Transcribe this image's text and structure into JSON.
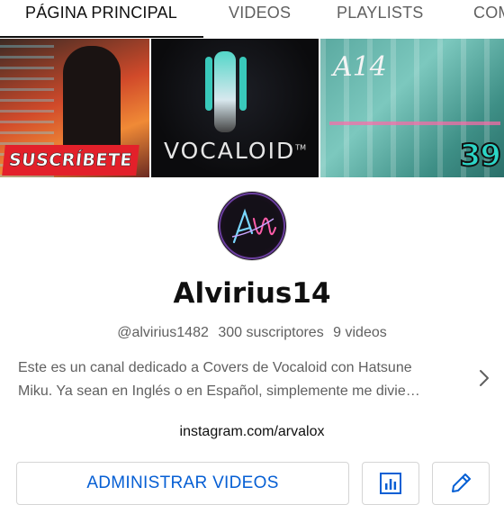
{
  "tabs": [
    {
      "label": "PÁGINA PRINCIPAL",
      "active": true
    },
    {
      "label": "VIDEOS",
      "active": false
    },
    {
      "label": "PLAYLISTS",
      "active": false
    },
    {
      "label": "COM",
      "active": false
    }
  ],
  "banner": {
    "panel1_text": "SUSCRÍBETE",
    "panel2_text": "VOCALOID",
    "panel2_tm": "TM",
    "panel3_text": "A14",
    "panel3_badge": "39"
  },
  "channel": {
    "name": "Alvirius14",
    "handle": "@alvirius1482",
    "subscribers": "300 suscriptores",
    "videos": "9 videos",
    "description_line1": "Este es un canal dedicado a Covers de Vocaloid con Hatsune",
    "description_line2": "Miku. Ya sean en Inglés o en Español, simplemente me divie…",
    "link": "instagram.com/arvalox"
  },
  "actions": {
    "manage_videos": "ADMINISTRAR VIDEOS",
    "analytics_icon": "bar-chart-icon",
    "edit_icon": "pencil-icon"
  },
  "colors": {
    "accent": "#065fd4",
    "text_primary": "#0f0f0f",
    "text_secondary": "#606060"
  }
}
